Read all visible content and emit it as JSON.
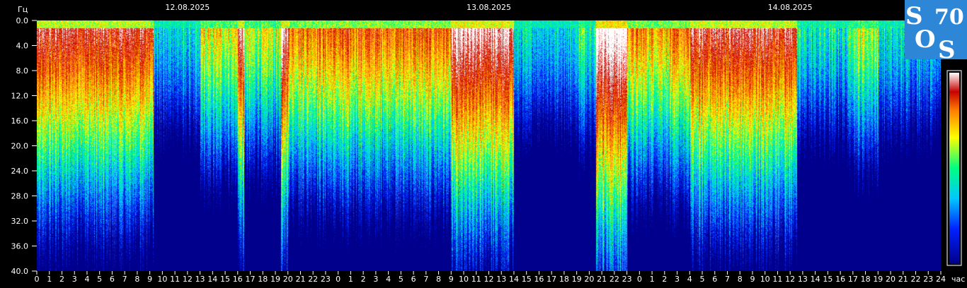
{
  "chart_data": {
    "type": "heatmap",
    "title": "",
    "ylabel": "Гц",
    "xlabel": "час",
    "ylim": [
      0,
      40
    ],
    "y_ticks": [
      "0.0",
      "4.0",
      "8.0",
      "12.0",
      "16.0",
      "20.0",
      "24.0",
      "28.0",
      "32.0",
      "36.0",
      "40.0"
    ],
    "x_ticks": [
      "0",
      "1",
      "2",
      "3",
      "4",
      "5",
      "6",
      "7",
      "8",
      "9",
      "10",
      "11",
      "12",
      "13",
      "14",
      "15",
      "16",
      "17",
      "18",
      "19",
      "20",
      "21",
      "22",
      "23",
      "0",
      "1",
      "2",
      "3",
      "4",
      "5",
      "6",
      "7",
      "8",
      "9",
      "10",
      "11",
      "12",
      "13",
      "14",
      "15",
      "16",
      "17",
      "18",
      "19",
      "20",
      "21",
      "22",
      "23",
      "0",
      "1",
      "2",
      "3",
      "4",
      "5",
      "6",
      "7",
      "8",
      "9",
      "10",
      "11",
      "12",
      "13",
      "14",
      "15",
      "16",
      "17",
      "18",
      "19",
      "20",
      "21",
      "22",
      "23",
      "24"
    ],
    "dates": [
      {
        "label": "12.08.2025",
        "hour": 12
      },
      {
        "label": "13.08.2025",
        "hour": 36
      },
      {
        "label": "14.08.2025",
        "hour": 60
      }
    ],
    "hours_total": 72,
    "colorscale": [
      "#00008c",
      "#0022ff",
      "#00c8ff",
      "#00ff80",
      "#ffff00",
      "#ff8000",
      "#c80000",
      "#ffffff"
    ],
    "activity": [
      {
        "start": 0,
        "end": 9.3,
        "level": 0.62
      },
      {
        "start": 9.3,
        "end": 13.0,
        "level": 0.08
      },
      {
        "start": 13.0,
        "end": 16.0,
        "level": 0.35
      },
      {
        "start": 16.0,
        "end": 16.5,
        "level": 0.7
      },
      {
        "start": 16.5,
        "end": 19.4,
        "level": 0.3
      },
      {
        "start": 19.4,
        "end": 20.0,
        "level": 0.75
      },
      {
        "start": 20.0,
        "end": 33.0,
        "level": 0.5
      },
      {
        "start": 33.0,
        "end": 38.0,
        "level": 0.72
      },
      {
        "start": 38.0,
        "end": 43.0,
        "level": 0.08
      },
      {
        "start": 43.0,
        "end": 44.5,
        "level": 0.2
      },
      {
        "start": 44.5,
        "end": 47.0,
        "level": 0.85
      },
      {
        "start": 47.0,
        "end": 52.0,
        "level": 0.45
      },
      {
        "start": 52.0,
        "end": 60.5,
        "level": 0.65
      },
      {
        "start": 60.5,
        "end": 64.7,
        "level": 0.12
      },
      {
        "start": 64.7,
        "end": 67.0,
        "level": 0.3
      },
      {
        "start": 67.0,
        "end": 72.0,
        "level": 0.1
      }
    ]
  },
  "logo": {
    "letters": [
      "S",
      "O",
      "S"
    ],
    "number": "70",
    "background": "#2e86d6"
  },
  "colors": {
    "background": "#000000",
    "text": "#ffffff"
  }
}
